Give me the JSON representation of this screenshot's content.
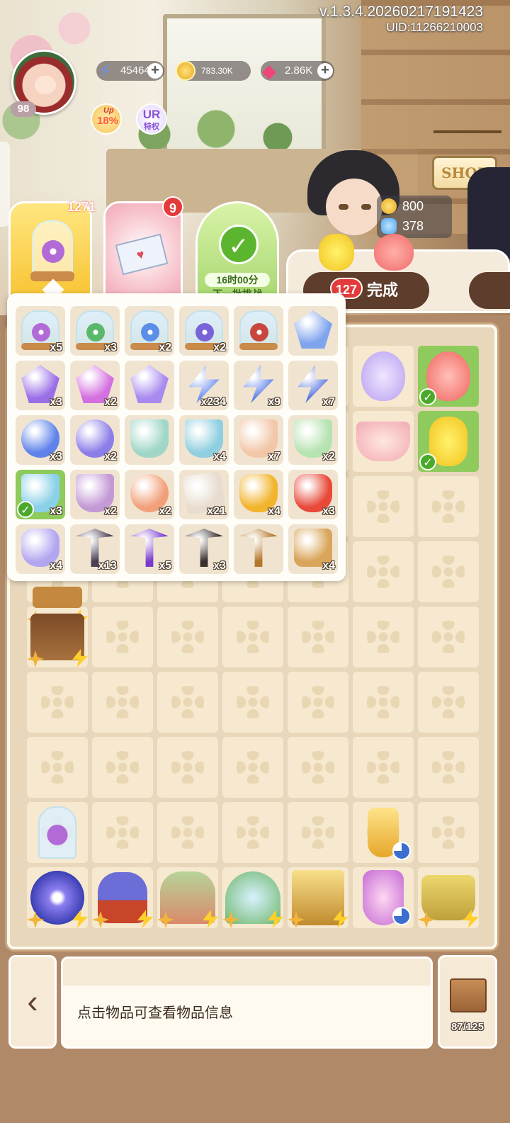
{
  "hud": {
    "version": "v.1.3.4.20260217191423",
    "uid": "UID:11266210003",
    "player_level": "98",
    "energy": "45464",
    "coins": "783.30K",
    "gems": "2.86K",
    "plus": "+",
    "buff_up_label": "Up",
    "buff_up_value": "18%",
    "buff_ur_line1": "UR",
    "buff_ur_line2": "特权"
  },
  "shop": {
    "label": "SHOP"
  },
  "orders": {
    "order1_count": "1271",
    "order2_count": "9",
    "order3_timer": "16时00分",
    "order3_sub": "下一批挑战"
  },
  "reward": {
    "coins": "800",
    "butterflies": "378"
  },
  "complete": {
    "label": "完成",
    "badge": "127"
  },
  "inventory": {
    "items": [
      {
        "name": "purple-flower-jar",
        "qty": "x5",
        "color": "#b26ad6",
        "selected": false
      },
      {
        "name": "green-clover-jar",
        "qty": "x3",
        "color": "#59b86a",
        "selected": false
      },
      {
        "name": "blue-crystal-jar",
        "qty": "x2",
        "color": "#5a8ee8",
        "selected": false
      },
      {
        "name": "lavender-jar",
        "qty": "x2",
        "color": "#7a63d8",
        "selected": false
      },
      {
        "name": "tree-jar",
        "qty": "",
        "color": "#c8463e",
        "selected": false
      },
      {
        "name": "blue-crystal",
        "qty": "",
        "color": "#7fa4ee",
        "selected": false
      },
      {
        "name": "purple-crystal",
        "qty": "x3",
        "color": "#9b6ee8",
        "selected": false
      },
      {
        "name": "pink-crystal",
        "qty": "x2",
        "color": "#d46fe0",
        "selected": false
      },
      {
        "name": "crystal-cluster",
        "qty": "",
        "color": "#a88af0",
        "selected": false
      },
      {
        "name": "energy-bolt",
        "qty": "x234",
        "color": "#6f8ff0",
        "selected": false
      },
      {
        "name": "energy-bolts-2",
        "qty": "x9",
        "color": "#5d7fe8",
        "selected": false
      },
      {
        "name": "energy-bolts-3",
        "qty": "x7",
        "color": "#5572e0",
        "selected": false
      },
      {
        "name": "energy-orb",
        "qty": "x3",
        "color": "#5f83ea",
        "selected": false
      },
      {
        "name": "energy-orb-large",
        "qty": "x2",
        "color": "#8c7ee8",
        "selected": false
      },
      {
        "name": "green-tea-bowl",
        "qty": "",
        "color": "#9fd6c8",
        "selected": false
      },
      {
        "name": "tea-cup-blue",
        "qty": "x4",
        "color": "#8fcfe0",
        "selected": false
      },
      {
        "name": "cat-tea-cup",
        "qty": "x7",
        "color": "#f2c7a8",
        "selected": false
      },
      {
        "name": "flower-tea-cup",
        "qty": "x2",
        "color": "#b6e3b2",
        "selected": false
      },
      {
        "name": "cat-latte",
        "qty": "x3",
        "color": "#8ad0e8",
        "selected": true
      },
      {
        "name": "cat-pudding",
        "qty": "x2",
        "color": "#c49ad6",
        "selected": false
      },
      {
        "name": "koi-fish",
        "qty": "x2",
        "color": "#f2a07a",
        "selected": false
      },
      {
        "name": "gift-box",
        "qty": "x21",
        "color": "#e8dccf",
        "selected": false
      },
      {
        "name": "amber-gem",
        "qty": "x4",
        "color": "#f2b42c",
        "selected": false
      },
      {
        "name": "ruby-gem",
        "qty": "x3",
        "color": "#e84a3a",
        "selected": false
      },
      {
        "name": "opal-gem",
        "qty": "x4",
        "color": "#b3a6f0",
        "selected": false
      },
      {
        "name": "pickaxe-dark",
        "qty": "x13",
        "color": "#4a3f55",
        "selected": false
      },
      {
        "name": "pickaxe-purple",
        "qty": "x5",
        "color": "#7a3ad0",
        "selected": false
      },
      {
        "name": "pickaxe-rose",
        "qty": "x3",
        "color": "#3a3030",
        "selected": false
      },
      {
        "name": "pickaxe-gold",
        "qty": "",
        "color": "#b5772a",
        "selected": false
      },
      {
        "name": "seed-bag",
        "qty": "x4",
        "color": "#d9a55a",
        "selected": false
      }
    ]
  },
  "info": {
    "hint": "点击物品可查看物品信息"
  },
  "storage": {
    "count": "87/125"
  },
  "colors": {
    "accent_green": "#8fca5c",
    "badge_red": "#e33b3b",
    "board_bg": "#e8d7bb"
  }
}
